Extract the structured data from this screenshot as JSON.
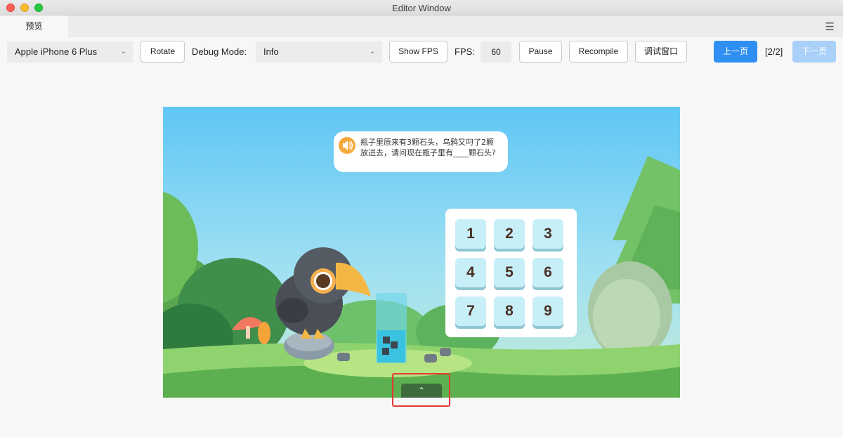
{
  "window": {
    "title": "Editor Window"
  },
  "tabs": [
    {
      "label": "预览"
    }
  ],
  "toolbar": {
    "device": "Apple iPhone 6 Plus",
    "rotate": "Rotate",
    "debug_mode_label": "Debug Mode:",
    "debug_mode_value": "Info",
    "show_fps": "Show FPS",
    "fps_label": "FPS:",
    "fps_value": "60",
    "pause": "Pause",
    "recompile": "Recompile",
    "debug_window": "调试窗口",
    "prev_page": "上一页",
    "page_indicator": "[2/2]",
    "next_page": "下一页"
  },
  "game": {
    "question": "瓶子里原来有3颗石头，乌鸦又叼了2颗放进去，请问现在瓶子里有____颗石头?",
    "keys": [
      "1",
      "2",
      "3",
      "4",
      "5",
      "6",
      "7",
      "8",
      "9"
    ]
  },
  "icons": {
    "speaker": "speaker-icon",
    "up": "chevron-up-icon",
    "menu": "hamburger-menu-icon"
  },
  "colors": {
    "primary": "#2f8ef2",
    "highlight": "#e53935"
  }
}
